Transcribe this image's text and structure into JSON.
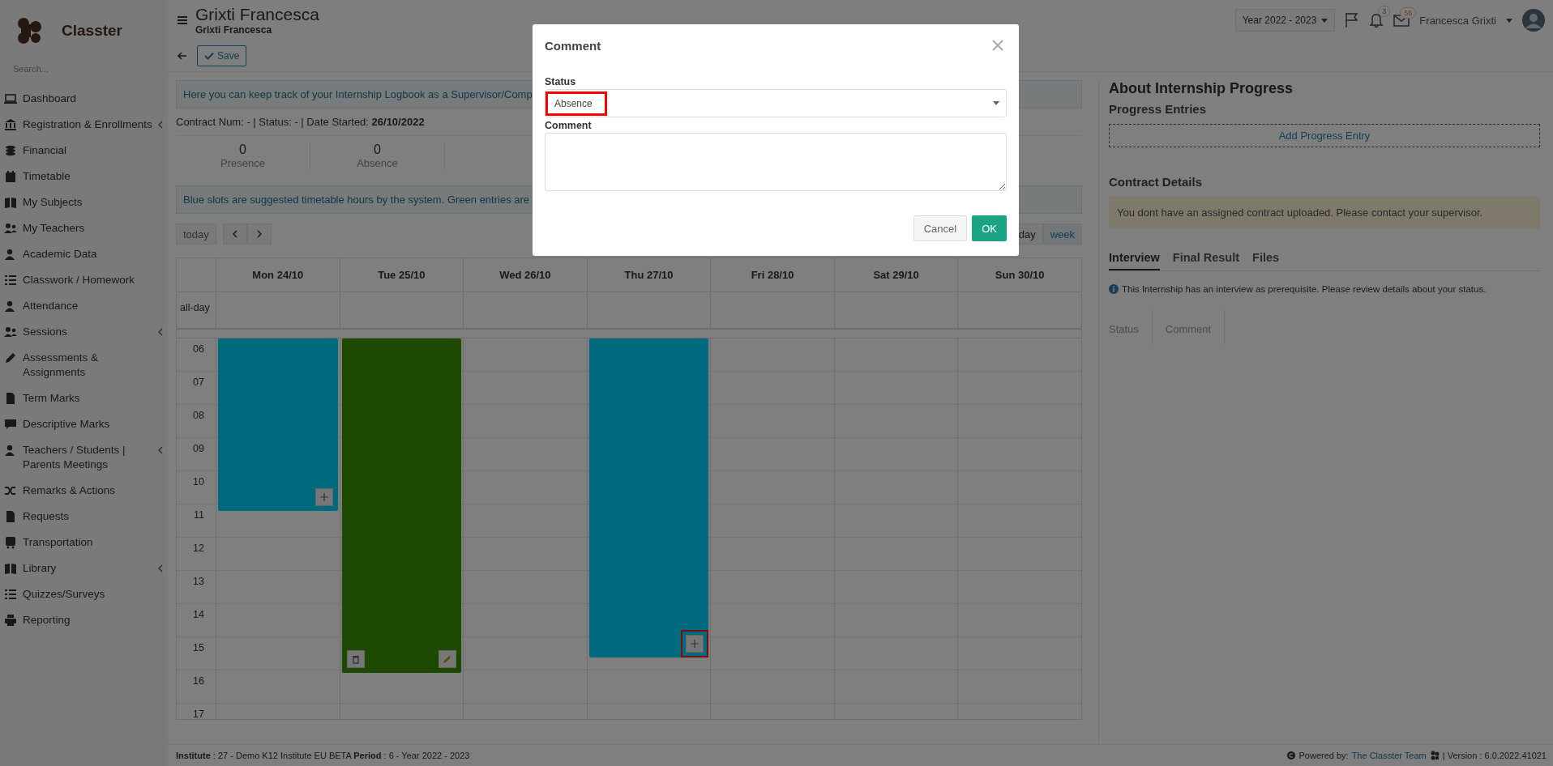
{
  "app": {
    "name": "Classter",
    "search_placeholder": "Search..."
  },
  "sidebar": {
    "items": [
      {
        "label": "Dashboard",
        "has_submenu": false
      },
      {
        "label": "Registration & Enrollments",
        "has_submenu": true
      },
      {
        "label": "Financial",
        "has_submenu": false
      },
      {
        "label": "Timetable",
        "has_submenu": false
      },
      {
        "label": "My Subjects",
        "has_submenu": false
      },
      {
        "label": "My Teachers",
        "has_submenu": false
      },
      {
        "label": "Academic Data",
        "has_submenu": false
      },
      {
        "label": "Classwork / Homework",
        "has_submenu": false
      },
      {
        "label": "Attendance",
        "has_submenu": false
      },
      {
        "label": "Sessions",
        "has_submenu": true
      },
      {
        "label": "Assessments & Assignments",
        "has_submenu": false
      },
      {
        "label": "Term Marks",
        "has_submenu": false
      },
      {
        "label": "Descriptive Marks",
        "has_submenu": false
      },
      {
        "label": "Teachers / Students | Parents Meetings",
        "has_submenu": true
      },
      {
        "label": "Remarks & Actions",
        "has_submenu": false
      },
      {
        "label": "Requests",
        "has_submenu": false
      },
      {
        "label": "Transportation",
        "has_submenu": false
      },
      {
        "label": "Library",
        "has_submenu": true
      },
      {
        "label": "Quizzes/Surveys",
        "has_submenu": false
      },
      {
        "label": "Reporting",
        "has_submenu": false
      }
    ]
  },
  "header": {
    "title": "Grixti Francesca",
    "subtitle": "Grixti Francesca",
    "year": "Year 2022 - 2023",
    "notifications": "3",
    "messages": "56",
    "user": "Francesca Grixti"
  },
  "toolbar": {
    "save": "Save"
  },
  "info_banner": "Here you can keep track of your Internship Logbook as a Supervisor/Comp",
  "contract_line": "Contract Num: -   | Status: - | Date Started: **26/10/2022**",
  "stats": [
    {
      "value": "0",
      "label": "Presence"
    },
    {
      "value": "0",
      "label": "Absence"
    }
  ],
  "legend_banner": "Blue slots are suggested timetable hours by the system. Green entries are",
  "calendar": {
    "today": "today",
    "views": [
      {
        "label": "day",
        "selected": false
      },
      {
        "label": "week",
        "selected": true
      }
    ],
    "all_day": "all-day",
    "days": [
      {
        "label": "Mon 24/10",
        "events": [
          {
            "kind": "suggested",
            "highlighted": false
          }
        ]
      },
      {
        "label": "Tue 25/10",
        "events": [
          {
            "kind": "entry"
          }
        ]
      },
      {
        "label": "Wed 26/10"
      },
      {
        "label": "Thu 27/10",
        "events": [
          {
            "kind": "suggested",
            "highlighted": true
          }
        ]
      },
      {
        "label": "Fri 28/10"
      },
      {
        "label": "Sat 29/10"
      },
      {
        "label": "Sun 30/10"
      }
    ],
    "hours": [
      "06",
      "07",
      "08",
      "09",
      "10",
      "11",
      "12",
      "13",
      "14",
      "15",
      "16",
      "17"
    ]
  },
  "modal": {
    "title": "Comment",
    "status_label": "Status",
    "status_value": "Absence",
    "status_highlighted": true,
    "comment_label": "Comment",
    "cancel": "Cancel",
    "ok": "OK"
  },
  "right_panel": {
    "title": "About Internship Progress",
    "progress_heading": "Progress Entries",
    "add_entry": "Add Progress Entry",
    "contract_heading": "Contract Details",
    "contract_warning": "You dont have an assigned contract uploaded. Please contact your supervisor.",
    "tabs": [
      {
        "label": "Interview",
        "selected": true
      },
      {
        "label": "Final Result",
        "selected": false
      },
      {
        "label": "Files",
        "selected": false
      }
    ],
    "interview_info": "This Internship has an interview as prerequisite. Please review details about your status.",
    "table_columns": [
      "Status",
      "Comment"
    ]
  },
  "footer": {
    "institute": "**Institute** : 27 - Demo K12 Institute EU BETA **Period** : 6 - Year 2022 - 2023",
    "powered_by": "Powered by:",
    "team_link": "The Classter Team",
    "version": "| Version : 6.0.2022.41021"
  }
}
